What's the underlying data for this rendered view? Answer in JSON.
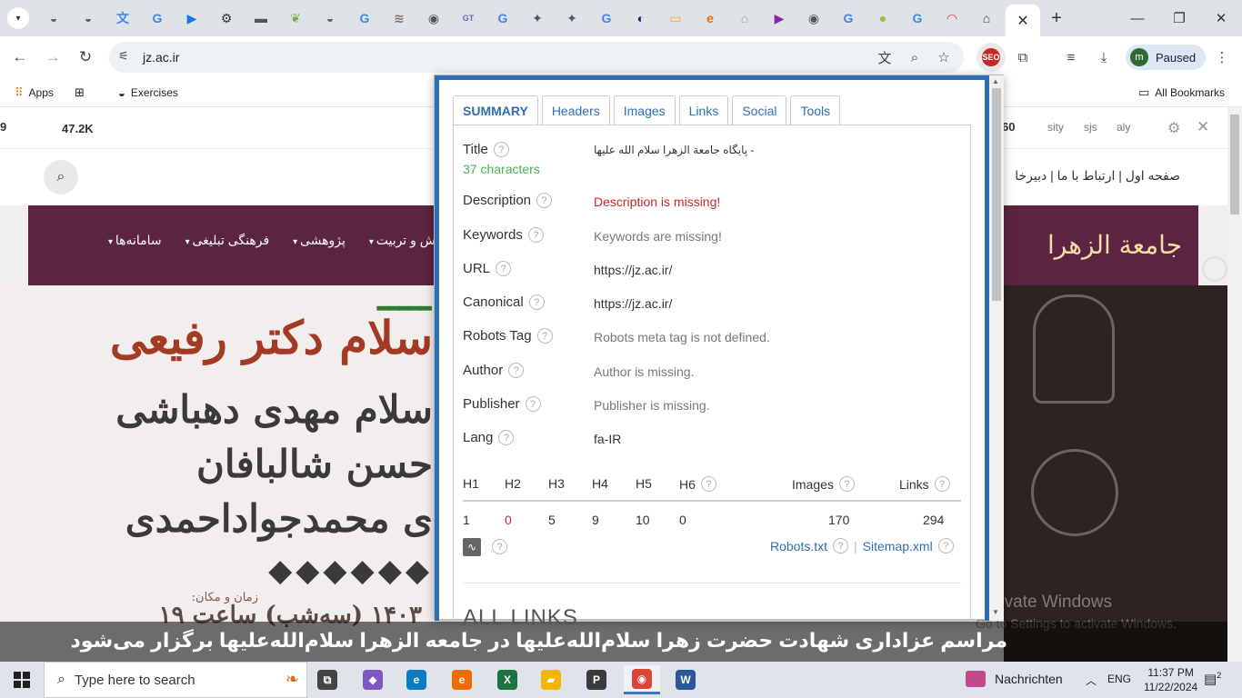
{
  "browser": {
    "tab_icons": [
      {
        "name": "globe-icon",
        "glyph": "◒",
        "color": "#5f6368"
      },
      {
        "name": "globe-icon",
        "glyph": "◒",
        "color": "#5f6368"
      },
      {
        "name": "translate-icon",
        "glyph": "文",
        "color": "#4285f4"
      },
      {
        "name": "google-icon",
        "glyph": "G",
        "color": "#4285f4"
      },
      {
        "name": "play-icon",
        "glyph": "▶",
        "color": "#1a73e8"
      },
      {
        "name": "gear-icon",
        "glyph": "⚙",
        "color": "#333333"
      },
      {
        "name": "car-icon",
        "glyph": "▬",
        "color": "#555555"
      },
      {
        "name": "leaf-icon",
        "glyph": "❦",
        "color": "#7cb342"
      },
      {
        "name": "globe-icon",
        "glyph": "◒",
        "color": "#5f6368"
      },
      {
        "name": "google-icon",
        "glyph": "G",
        "color": "#4285f4"
      },
      {
        "name": "dictionary-icon",
        "glyph": "≋",
        "color": "#8d6e63"
      },
      {
        "name": "shield-icon",
        "glyph": "◉",
        "color": "#555555"
      },
      {
        "name": "gt-icon",
        "glyph": "GT",
        "color": "#5c6bc0"
      },
      {
        "name": "google-icon",
        "glyph": "G",
        "color": "#4285f4"
      },
      {
        "name": "dart-icon",
        "glyph": "✦",
        "color": "#455a64"
      },
      {
        "name": "dart-icon",
        "glyph": "✦",
        "color": "#455a64"
      },
      {
        "name": "google-icon",
        "glyph": "G",
        "color": "#4285f4"
      },
      {
        "name": "circle-icon",
        "glyph": "◐",
        "color": "#1a237e"
      },
      {
        "name": "note-icon",
        "glyph": "▭",
        "color": "#f9a825"
      },
      {
        "name": "edge-icon",
        "glyph": "e",
        "color": "#ef6c00"
      },
      {
        "name": "mosque-icon",
        "glyph": "⌂",
        "color": "#90a4ae"
      },
      {
        "name": "video-icon",
        "glyph": "▶",
        "color": "#8e24aa"
      },
      {
        "name": "shield-icon",
        "glyph": "◉",
        "color": "#555555"
      },
      {
        "name": "google-icon",
        "glyph": "G",
        "color": "#4285f4"
      },
      {
        "name": "android-icon",
        "glyph": "●",
        "color": "#8bc34a"
      },
      {
        "name": "google-icon",
        "glyph": "G",
        "color": "#4285f4"
      },
      {
        "name": "rainbow-icon",
        "glyph": "◠",
        "color": "#e53935"
      },
      {
        "name": "building-icon",
        "glyph": "⌂",
        "color": "#37474f"
      }
    ],
    "active_tab_close": "✕",
    "new_tab": "+",
    "url": "jz.ac.ir",
    "profile_initial": "m",
    "profile_label": "Paused",
    "bookmarks": {
      "apps": "Apps",
      "exercises": "Exercises",
      "all_bookmarks": "All Bookmarks"
    }
  },
  "page": {
    "topstrip": {
      "left_fragment": "9",
      "count": "47.2K",
      "badge_value": "60",
      "right_icons": [
        "ahrefs-icon",
        "sjs-icon",
        "aly-icon"
      ],
      "right_labels": [
        "sity",
        "sjs",
        "aly"
      ]
    },
    "top_links": "صفحه اول | ارتباط با ما | دبیرخا",
    "nav_menu": [
      "سامانه‌ها",
      "فرهنگی تبلیغی",
      "پژوهشی",
      "ش و تربیت"
    ],
    "logo_text": "جامعة الزهرا",
    "poster_lines": [
      "سلام دکتر رفیعی",
      "سلام مهدی دهباشی",
      "حسن شالبافان",
      "ی محمدجواداحمدی",
      "زمان و مکان:",
      "۱۴۰۳ (سه‌شب) ساعت ۱۹"
    ],
    "caption": "مراسم عزاداری شهادت حضرت زهرا سلام‌الله‌علیها در جامعه الزهرا سلام‌الله‌علیها برگزار می‌شود",
    "activate_title": "Activate Windows",
    "activate_sub": "Go to Settings to activate Windows."
  },
  "seo": {
    "tabs": [
      "SUMMARY",
      "Headers",
      "Images",
      "Links",
      "Social",
      "Tools"
    ],
    "rows": [
      {
        "label": "Title",
        "value": "- پایگاه جامعة الزهرا سلام الله علیها",
        "sub": "37 characters",
        "status": "ok"
      },
      {
        "label": "Description",
        "value": "Description is missing!",
        "status": "error"
      },
      {
        "label": "Keywords",
        "value": "Keywords are missing!",
        "status": "missing"
      },
      {
        "label": "URL",
        "value": "https://jz.ac.ir/",
        "status": "ok"
      },
      {
        "label": "Canonical",
        "value": "https://jz.ac.ir/",
        "status": "ok"
      },
      {
        "label": "Robots Tag",
        "value": "Robots meta tag is not defined.",
        "status": "missing"
      },
      {
        "label": "Author",
        "value": "Author is missing.",
        "status": "missing"
      },
      {
        "label": "Publisher",
        "value": "Publisher is missing.",
        "status": "missing"
      },
      {
        "label": "Lang",
        "value": "fa-IR",
        "status": "ok"
      }
    ],
    "headers_table": {
      "columns": [
        "H1",
        "H2",
        "H3",
        "H4",
        "H5",
        "H6",
        "Images",
        "Links"
      ],
      "values": [
        "1",
        "0",
        "5",
        "9",
        "10",
        "0",
        "170",
        "294"
      ]
    },
    "robots_link": "Robots.txt",
    "sitemap_link": "Sitemap.xml",
    "all_links_heading": "ALL LINKS"
  },
  "taskbar": {
    "search_placeholder": "Type here to search",
    "apps": [
      {
        "name": "task-view-icon",
        "glyph": "⧉",
        "color": "#444444"
      },
      {
        "name": "copilot-icon",
        "glyph": "◆",
        "color": "#7e57c2"
      },
      {
        "name": "edge-icon",
        "glyph": "e",
        "color": "#0a7cc4"
      },
      {
        "name": "edge-dev-icon",
        "glyph": "e",
        "color": "#ef6c00"
      },
      {
        "name": "excel-icon",
        "glyph": "X",
        "color": "#1e7145"
      },
      {
        "name": "file-explorer-icon",
        "glyph": "▰",
        "color": "#f2b600"
      },
      {
        "name": "p-app-icon",
        "glyph": "P",
        "color": "#3b3b3b"
      },
      {
        "name": "chrome-icon",
        "glyph": "◉",
        "color": "#db4437"
      },
      {
        "name": "word-icon",
        "glyph": "W",
        "color": "#2b579a"
      }
    ],
    "news": "Nachrichten",
    "lang": "ENG",
    "time": "11:37 PM",
    "date": "11/22/2024",
    "notifications": "2"
  }
}
